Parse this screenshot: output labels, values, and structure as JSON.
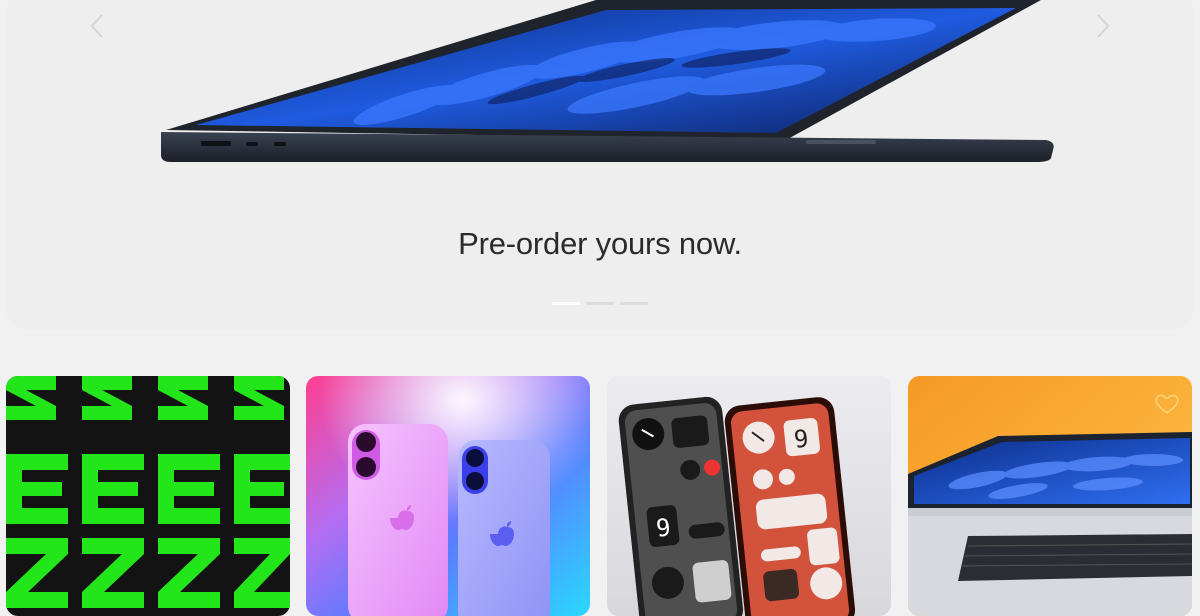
{
  "hero": {
    "caption": "Pre-order yours now.",
    "prev_icon": "chevron-left-icon",
    "next_icon": "chevron-right-icon",
    "slides": 3,
    "active_slide": 1
  },
  "cards": [
    {
      "name": "nothing-logo-promo"
    },
    {
      "name": "iphone-pink-blue"
    },
    {
      "name": "nothing-phones"
    },
    {
      "name": "macbook-air-yellow"
    }
  ],
  "colors": {
    "hero_bg": "#eeeeee",
    "page_bg": "#f1f1f1",
    "neon_green": "#22e51a",
    "caption": "#2b2b2b"
  }
}
